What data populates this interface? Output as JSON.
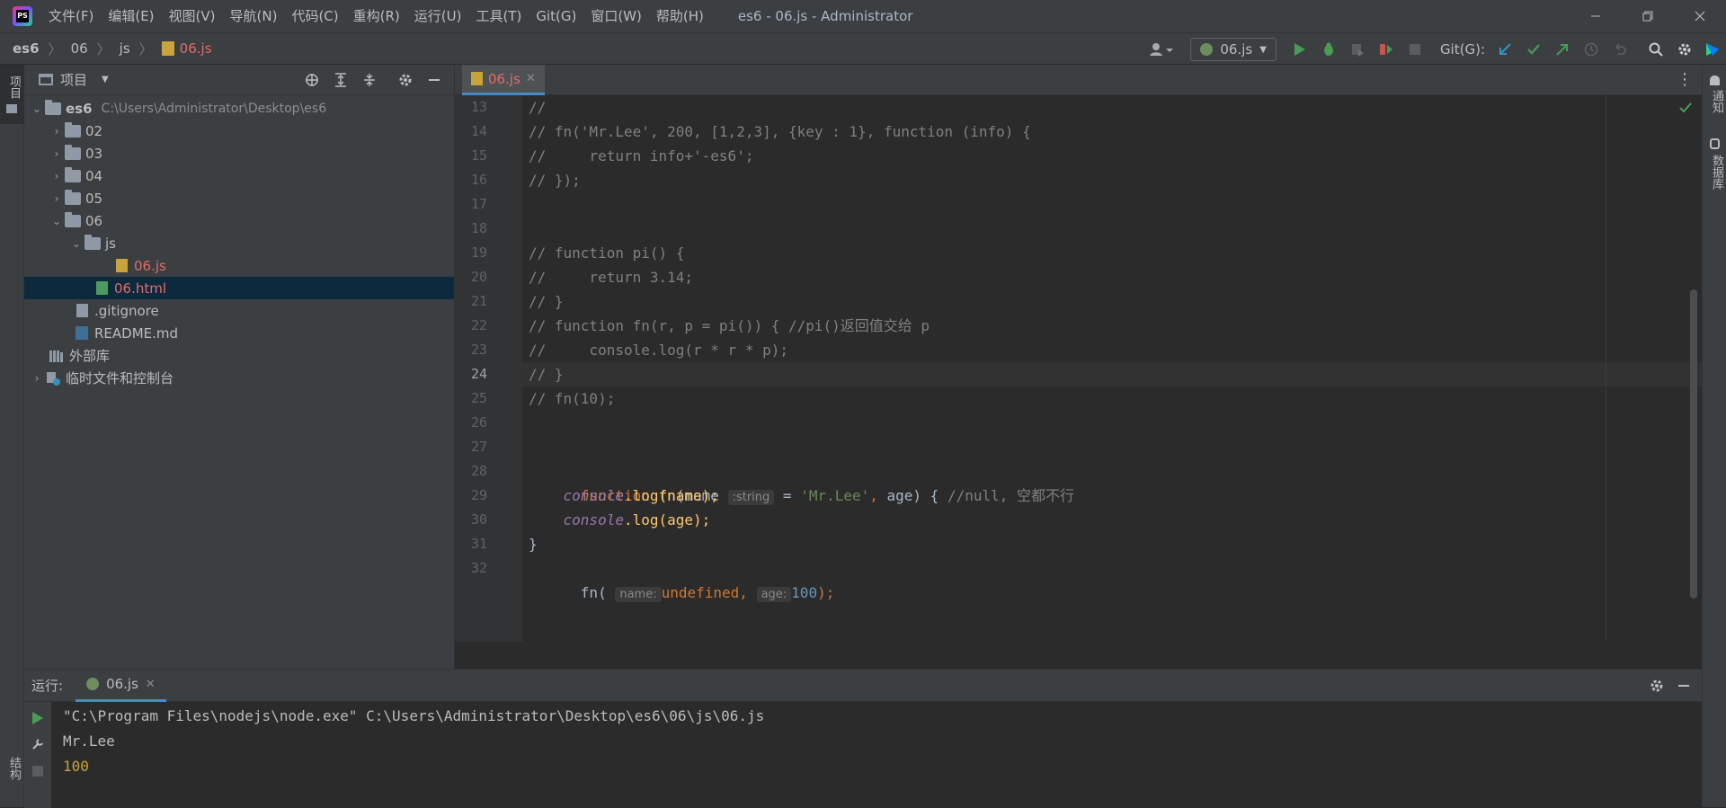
{
  "window": {
    "title": "es6 - 06.js - Administrator",
    "menu": [
      "文件(F)",
      "编辑(E)",
      "视图(V)",
      "导航(N)",
      "代码(C)",
      "重构(R)",
      "运行(U)",
      "工具(T)",
      "Git(G)",
      "窗口(W)",
      "帮助(H)"
    ]
  },
  "breadcrumb": {
    "items": [
      "es6",
      "06",
      "js"
    ],
    "file": "06.js"
  },
  "toolbar": {
    "run_config": "06.js",
    "git_label": "Git(G):"
  },
  "sidebar": {
    "left_label": "项目",
    "right_labels": [
      "通知",
      "数据库"
    ],
    "bottom_label": "结构"
  },
  "project": {
    "title": "项目",
    "root": {
      "name": "es6",
      "path": "C:\\Users\\Administrator\\Desktop\\es6"
    },
    "items": [
      "02",
      "03",
      "04",
      "05",
      "06",
      "js",
      "06.js",
      "06.html",
      ".gitignore",
      "README.md",
      "外部库",
      "临时文件和控制台"
    ]
  },
  "editor": {
    "tab": "06.js",
    "line_numbers": [
      "13",
      "14",
      "15",
      "16",
      "17",
      "18",
      "19",
      "20",
      "21",
      "22",
      "23",
      "24",
      "25",
      "26",
      "27",
      "28",
      "29",
      "30",
      "31",
      "32"
    ],
    "lines": {
      "l13": "//",
      "l14": "// fn('Mr.Lee', 200, [1,2,3], {key : 1}, function (info) {",
      "l15": "//     return info+'-es6';",
      "l16": "// });",
      "l19": "// function pi() {",
      "l20": "//     return 3.14;",
      "l21": "// }",
      "l22": "// function fn(r, p = pi()) { //pi()返回值交给 p",
      "l23": "//     console.log(r * r * p);",
      "l24": "// }",
      "l25": "// fn(10);",
      "l28_kw": "function",
      "l28_fn": "fn",
      "l28_a": "(name",
      "l28_hint": ":string",
      "l28_b": " = ",
      "l28_str": "'Mr.Lee'",
      "l28_c": ", ",
      "l28_d": "age) { ",
      "l28_comment": "//null, 空都不行",
      "l29_obj": "console",
      "l29_rest": ".log(name);",
      "l30_obj": "console",
      "l30_rest": ".log(age);",
      "l31": "}",
      "l32_a": "fn(",
      "l32_hint1": "name:",
      "l32_undef": "undefined, ",
      "l32_hint2": "age:",
      "l32_num": "100",
      "l32_end": ");"
    }
  },
  "run": {
    "label": "运行:",
    "tab": "06.js",
    "output": [
      "\"C:\\Program Files\\nodejs\\node.exe\" C:\\Users\\Administrator\\Desktop\\es6\\06\\js\\06.js",
      "Mr.Lee",
      "100"
    ]
  }
}
